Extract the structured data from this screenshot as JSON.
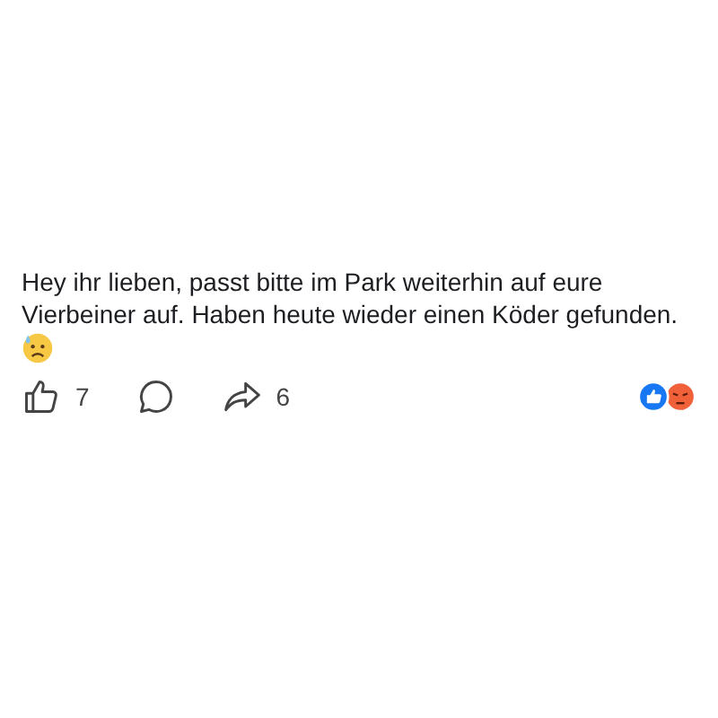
{
  "post": {
    "text": "Hey ihr lieben, passt bitte im Park weiterhin auf eure Vierbeiner auf. Haben heute wieder einen Köder gefunden."
  },
  "actions": [
    {
      "kind": "like",
      "count": "7"
    },
    {
      "kind": "comment"
    },
    {
      "kind": "share",
      "count": "6"
    }
  ],
  "reactions": [
    {
      "kind": "like",
      "color": "#1877f2"
    },
    {
      "kind": "angry",
      "color": "#f0613a"
    }
  ]
}
